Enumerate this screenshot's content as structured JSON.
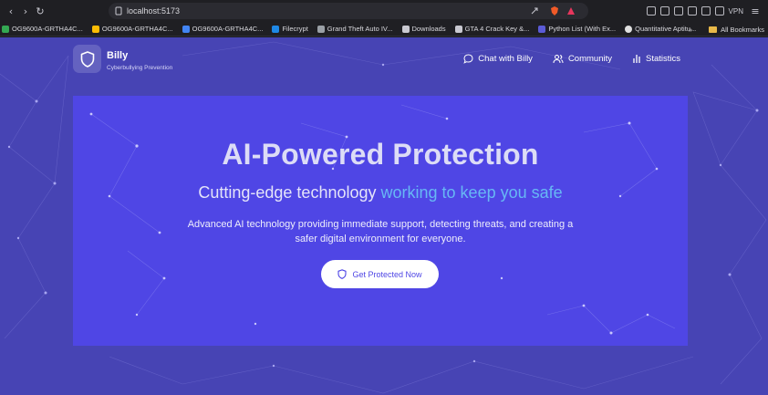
{
  "browser": {
    "url": "localhost:5173",
    "vpn_label": "VPN",
    "bookmarks": [
      {
        "label": "OG9600A-GRTHA4C...",
        "icon": "google-drive-icon",
        "color": "#34a853"
      },
      {
        "label": "OG9600A-GRTHA4C...",
        "icon": "google-drive-icon",
        "color": "#fbbc04"
      },
      {
        "label": "OG9600A-GRTHA4C...",
        "icon": "google-drive-icon",
        "color": "#4285f4"
      },
      {
        "label": "Filecrypt",
        "icon": "filecrypt-icon",
        "color": "#1e88e5"
      },
      {
        "label": "Grand Theft Auto IV...",
        "icon": "game-icon",
        "color": "#9aa0a6"
      },
      {
        "label": "Downloads",
        "icon": "download-icon",
        "color": "#c9c9d1"
      },
      {
        "label": "GTA 4 Crack Key &...",
        "icon": "page-icon",
        "color": "#c9c9d1"
      },
      {
        "label": "Python List (With Ex...",
        "icon": "python-icon",
        "color": "#5b5bd6"
      },
      {
        "label": "Quantitative Aptitu...",
        "icon": "site-icon",
        "color": "#e0e0e0"
      }
    ],
    "overflow": "»",
    "all_bookmarks": "All Bookmarks"
  },
  "site": {
    "brand": {
      "name": "Billy",
      "tagline": "Cyberbullying Prevention"
    },
    "nav": [
      {
        "label": "Chat with Billy",
        "icon": "chat-icon"
      },
      {
        "label": "Community",
        "icon": "users-icon"
      },
      {
        "label": "Statistics",
        "icon": "bar-chart-icon"
      }
    ],
    "hero": {
      "title": "AI-Powered Protection",
      "subtitle_main": "Cutting-edge technology",
      "subtitle_accent": "working to keep you safe",
      "description": "Advanced AI technology providing immediate support, detecting threats, and creating a safer digital environment for everyone.",
      "cta_label": "Get Protected Now"
    }
  },
  "colors": {
    "page_bg": "#4744b4",
    "hero_bg": "#4f46e5",
    "accent": "#67b8f4"
  }
}
